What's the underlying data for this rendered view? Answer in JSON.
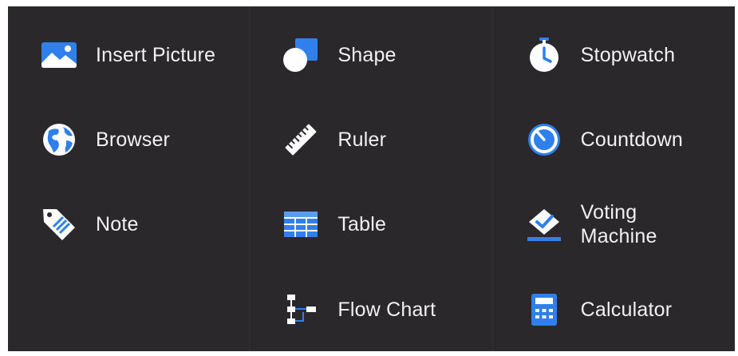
{
  "colors": {
    "panel_bg": "#2a282b",
    "accent_blue": "#2f80ed",
    "icon_white": "#ffffff",
    "label_text": "#f1f1f1"
  },
  "columns": [
    {
      "items": [
        {
          "label": "Insert Picture",
          "icon": "picture-icon"
        },
        {
          "label": "Browser",
          "icon": "globe-icon"
        },
        {
          "label": "Note",
          "icon": "tag-icon"
        }
      ]
    },
    {
      "items": [
        {
          "label": "Shape",
          "icon": "shapes-icon"
        },
        {
          "label": "Ruler",
          "icon": "ruler-icon"
        },
        {
          "label": "Table",
          "icon": "table-icon"
        },
        {
          "label": "Flow Chart",
          "icon": "flowchart-icon"
        }
      ]
    },
    {
      "items": [
        {
          "label": "Stopwatch",
          "icon": "stopwatch-icon"
        },
        {
          "label": "Countdown",
          "icon": "countdown-icon"
        },
        {
          "label": "Voting Machine",
          "icon": "voting-icon"
        },
        {
          "label": "Calculator",
          "icon": "calculator-icon"
        }
      ]
    }
  ]
}
